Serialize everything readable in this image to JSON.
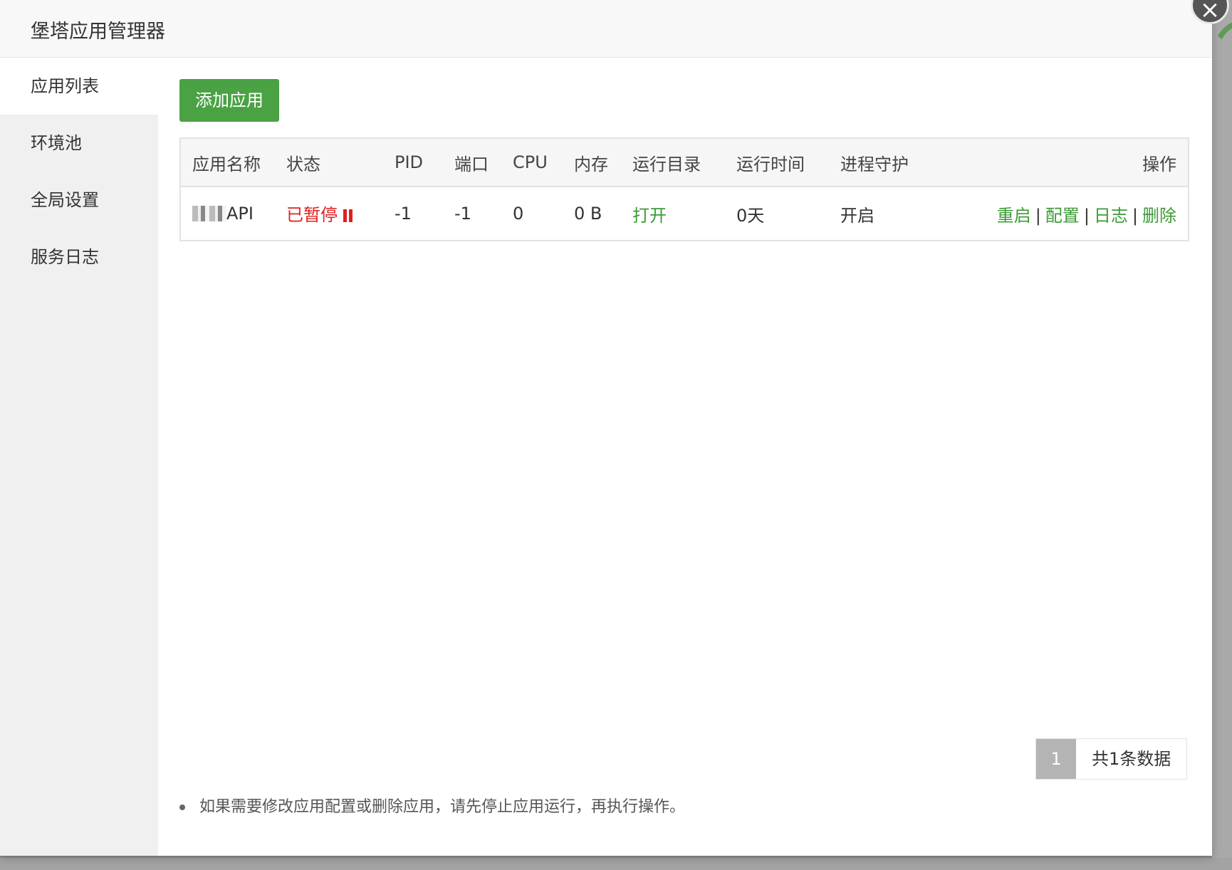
{
  "modal": {
    "title": "堡塔应用管理器",
    "close_label": "×"
  },
  "sidebar": {
    "items": [
      {
        "label": "应用列表",
        "active": true
      },
      {
        "label": "环境池",
        "active": false
      },
      {
        "label": "全局设置",
        "active": false
      },
      {
        "label": "服务日志",
        "active": false
      }
    ]
  },
  "toolbar": {
    "add_label": "添加应用"
  },
  "table": {
    "headers": [
      "应用名称",
      "状态",
      "PID",
      "端口",
      "CPU",
      "内存",
      "运行目录",
      "运行时间",
      "进程守护",
      "操作"
    ],
    "rows": [
      {
        "name": "API",
        "status": "已暂停",
        "pid": "-1",
        "port": "-1",
        "cpu": "0",
        "memory": "0 B",
        "dir": "打开",
        "uptime": "0天",
        "guard": "开启",
        "ops": [
          "重启",
          "配置",
          "日志",
          "删除"
        ]
      }
    ]
  },
  "pager": {
    "current": "1",
    "total": "共1条数据"
  },
  "tip": "如果需要修改应用配置或删除应用，请先停止应用运行，再执行操作。",
  "colors": {
    "accent": "#4aa244",
    "status_paused": "#e02020"
  }
}
